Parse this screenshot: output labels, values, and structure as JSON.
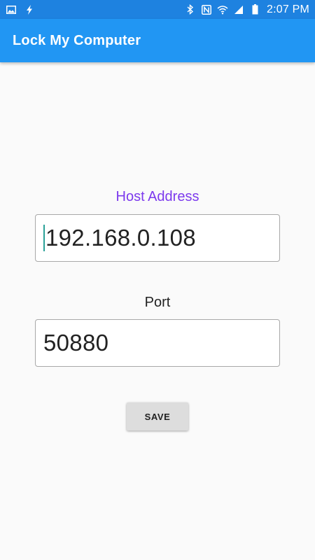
{
  "status_bar": {
    "time": "2:07 PM",
    "left_icons": [
      "image-icon",
      "flash-icon"
    ],
    "right_icons": [
      "bluetooth-icon",
      "nfc-icon",
      "wifi-icon",
      "signal-icon",
      "battery-icon"
    ]
  },
  "app_bar": {
    "title": "Lock My Computer"
  },
  "form": {
    "host_label": "Host Address",
    "host_value": "192.168.0.108",
    "port_label": "Port",
    "port_value": "50880",
    "save_label": "SAVE"
  },
  "colors": {
    "status_bar": "#1e82e0",
    "app_bar": "#2196f3",
    "focused_label": "#7c3aed",
    "background": "#fafafa"
  }
}
